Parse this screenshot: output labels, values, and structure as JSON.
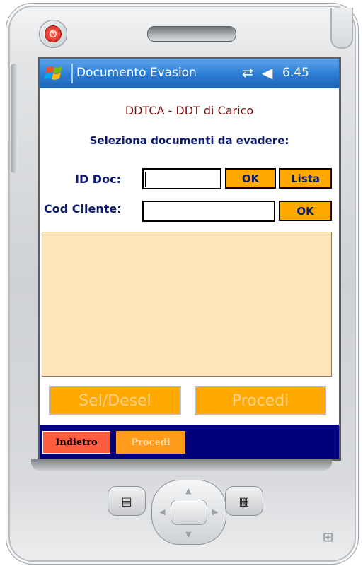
{
  "titlebar": {
    "title": "Documento Evasion",
    "clock": "6.45",
    "start_icon": "windows-flag-icon",
    "connectivity_icon": "connectivity-arrows-icon",
    "volume_icon": "speaker-volume-icon"
  },
  "form": {
    "title": "DDTCA - DDT di Carico",
    "subtitle": "Seleziona documenti da evadere:",
    "id_doc_label": "ID Doc:",
    "id_doc_value": "",
    "cod_cliente_label": "Cod Cliente:",
    "cod_cliente_value": "",
    "ok_label": "OK",
    "lista_label": "Lista",
    "ok2_label": "OK"
  },
  "actions": {
    "sel_desel_label": "Sel/Desel",
    "procedi_label": "Procedi"
  },
  "softkeys": {
    "indietro_label": "Indietro",
    "procedi_label": "Procedi"
  },
  "colors": {
    "button_orange": "#ffa800",
    "list_background": "#fde5b9",
    "title_dark_red": "#7a1414",
    "label_navy": "#0c1a6e",
    "softkey_bar": "#00007a",
    "indietro_red": "#ff5c3e"
  }
}
